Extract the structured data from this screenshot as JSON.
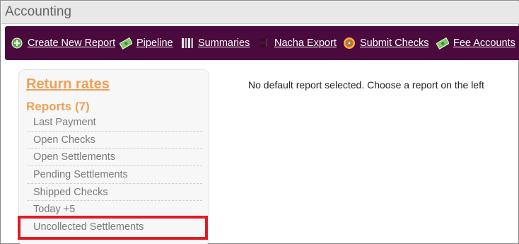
{
  "window": {
    "title": "Accounting"
  },
  "nav": {
    "items": [
      {
        "label": "Create New Report",
        "icon": "plus-circle-icon"
      },
      {
        "label": "Pipeline",
        "icon": "money-icon"
      },
      {
        "label": "Summaries",
        "icon": "columns-icon"
      },
      {
        "label": "Nacha Export",
        "icon": "file-stack-icon"
      },
      {
        "label": "Submit Checks",
        "icon": "target-icon"
      },
      {
        "label": "Fee Accounts",
        "icon": "money-icon"
      }
    ]
  },
  "sidebar": {
    "return_rates": "Return rates",
    "reports_heading": "Reports (7)",
    "reports": [
      "Last Payment",
      "Open Checks",
      "Open Settlements",
      "Pending Settlements",
      "Shipped Checks",
      "Today +5",
      "Uncollected Settlements"
    ]
  },
  "main": {
    "message": "No default report selected. Choose a report on the left"
  },
  "colors": {
    "nav_bg": "#4b0a3e",
    "accent_orange": "#f0a055",
    "highlight_red": "#e01b24"
  }
}
